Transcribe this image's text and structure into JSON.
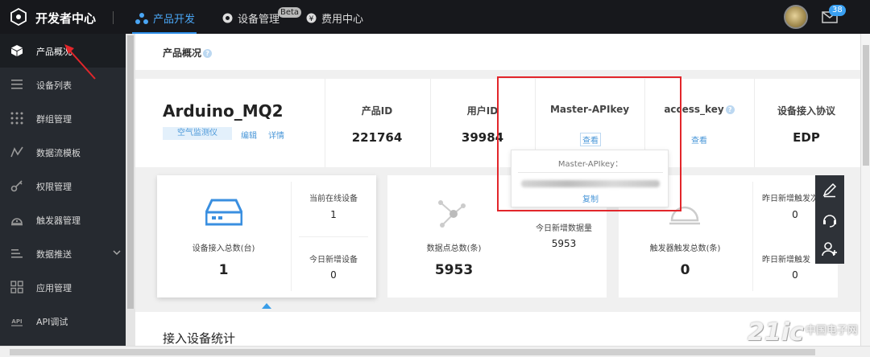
{
  "topbar": {
    "brand": "开发者中心",
    "nav": [
      {
        "label": "产品开发",
        "icon": "molecule-icon"
      },
      {
        "label": "设备管理",
        "icon": "record-icon",
        "badge": "Beta"
      },
      {
        "label": "费用中心",
        "icon": "yen-icon"
      }
    ],
    "mail_badge": "38"
  },
  "sidebar": {
    "items": [
      {
        "label": "产品概况",
        "icon": "cube-icon"
      },
      {
        "label": "设备列表",
        "icon": "list-icon"
      },
      {
        "label": "群组管理",
        "icon": "grid-dots-icon"
      },
      {
        "label": "数据流模板",
        "icon": "chart-line-icon"
      },
      {
        "label": "权限管理",
        "icon": "key-icon"
      },
      {
        "label": "触发器管理",
        "icon": "alarm-icon"
      },
      {
        "label": "数据推送",
        "icon": "push-icon"
      },
      {
        "label": "应用管理",
        "icon": "apps-icon"
      },
      {
        "label": "API调试",
        "icon": "api-icon"
      }
    ]
  },
  "page": {
    "title": "产品概况",
    "product_name": "Arduino_MQ2",
    "tag": "空气监测仪",
    "edit_label": "编辑",
    "detail_label": "详情",
    "columns": [
      {
        "label": "产品ID",
        "value": "221764"
      },
      {
        "label": "用户ID",
        "value": "39984"
      },
      {
        "label": "Master-APIkey",
        "link": "查看"
      },
      {
        "label": "access_key",
        "link": "查看"
      },
      {
        "label": "设备接入协议",
        "value": "EDP"
      }
    ],
    "popover": {
      "title": "Master-APIkey：",
      "copy": "复制"
    },
    "cards": {
      "device": {
        "main_label": "设备接入总数(台)",
        "main_value": "1",
        "online_label": "当前在线设备",
        "online_value": "1",
        "new_label": "今日新增设备",
        "new_value": "0"
      },
      "datapoints": {
        "main_label": "数据点总数(条)",
        "main_value": "5953",
        "new_label": "今日新增数据量",
        "new_value": "5953"
      },
      "triggers": {
        "main_label": "触发器触发总数(条)",
        "main_value": "0",
        "yesterday_label_1": "昨日新增触发次",
        "yesterday_value_1": "0",
        "yesterday_label_2": "昨日新增触发",
        "yesterday_value_2": "0"
      }
    },
    "section_title": "接入设备统计"
  },
  "watermark": {
    "main": "21ic",
    "sub": "中国电子网"
  },
  "colors": {
    "accent": "#2d8ee8",
    "highlight_box": "#e2262b",
    "sidebar_bg": "#262a30",
    "topbar_bg": "#17181c"
  }
}
